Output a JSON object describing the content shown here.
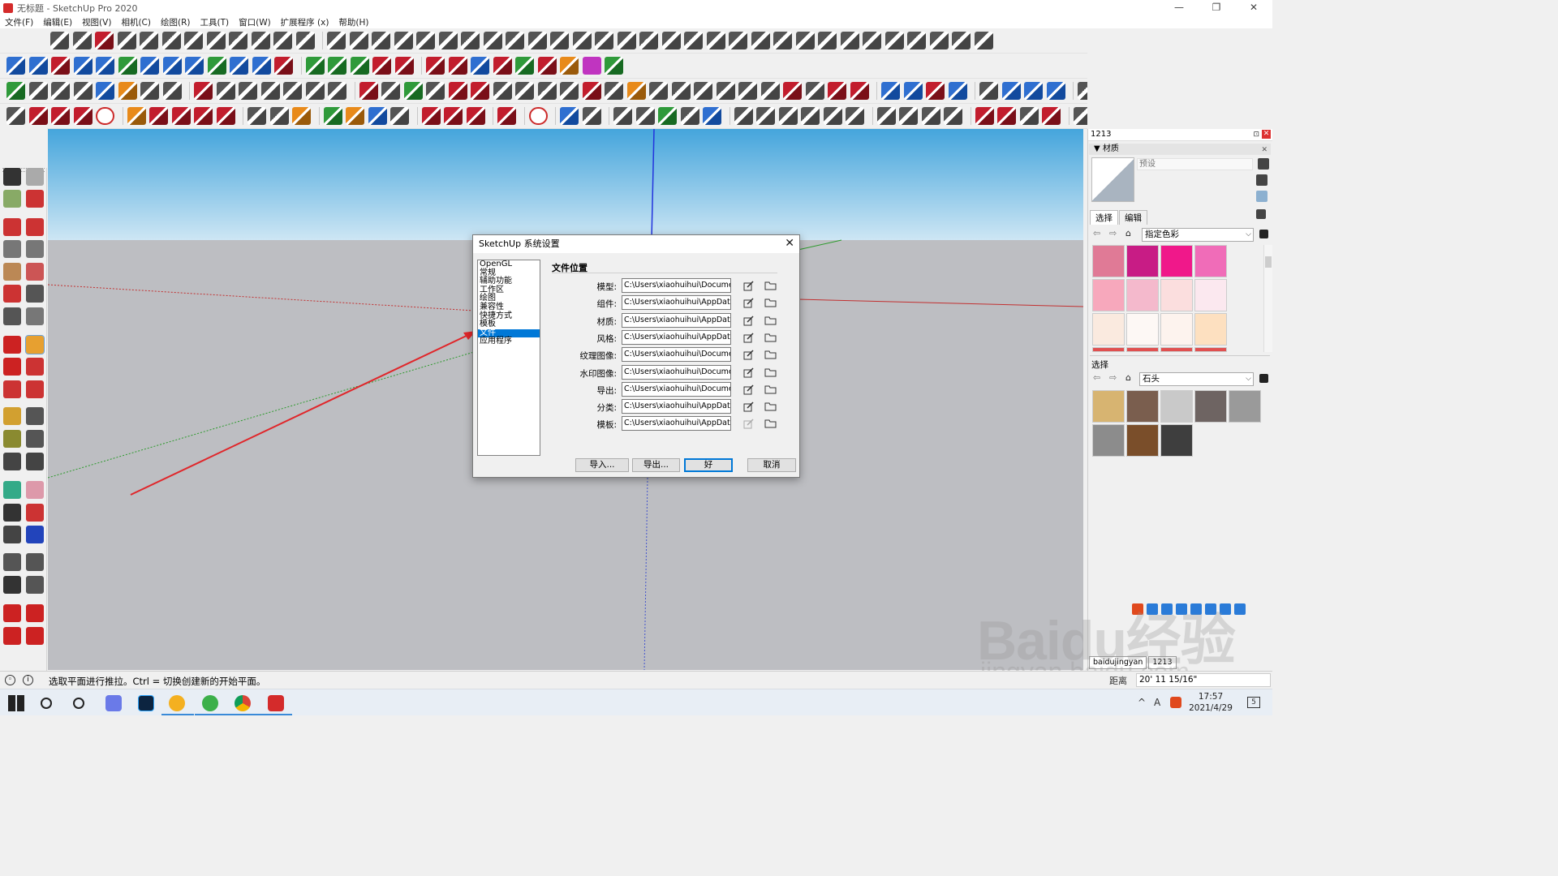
{
  "window": {
    "title": "无标题 - SketchUp Pro 2020",
    "min": "—",
    "restore": "❐",
    "close": "✕"
  },
  "menu": [
    "文件(F)",
    "编辑(E)",
    "视图(V)",
    "相机(C)",
    "绘图(R)",
    "工具(T)",
    "窗口(W)",
    "扩展程序 (x)",
    "帮助(H)"
  ],
  "dialog": {
    "title": "SketchUp 系统设置",
    "close": "✕",
    "categories": [
      "OpenGL",
      "常规",
      "辅助功能",
      "工作区",
      "绘图",
      "兼容性",
      "快捷方式",
      "模板",
      "文件",
      "应用程序"
    ],
    "selected_category": "文件",
    "section_title": "文件位置",
    "rows": [
      {
        "label": "模型:",
        "path": "C:\\Users\\xiaohuihui\\Documents\\"
      },
      {
        "label": "组件:",
        "path": "C:\\Users\\xiaohuihui\\AppData\\Roa"
      },
      {
        "label": "材质:",
        "path": "C:\\Users\\xiaohuihui\\AppData\\Roa"
      },
      {
        "label": "风格:",
        "path": "C:\\Users\\xiaohuihui\\AppData\\Roa"
      },
      {
        "label": "纹理图像:",
        "path": "C:\\Users\\xiaohuihui\\Documents\\"
      },
      {
        "label": "水印图像:",
        "path": "C:\\Users\\xiaohuihui\\Documents\\"
      },
      {
        "label": "导出:",
        "path": "C:\\Users\\xiaohuihui\\Documents\\"
      },
      {
        "label": "分类:",
        "path": "C:\\Users\\xiaohuihui\\AppData\\Roa"
      },
      {
        "label": "模板:",
        "path": "C:\\Users\\xiaohuihui\\AppData\\Roa"
      }
    ],
    "buttons": {
      "import": "导入...",
      "export": "导出...",
      "ok": "好",
      "cancel": "取消"
    }
  },
  "right_panel": {
    "tray_title": "1213",
    "pin": "⊡",
    "close": "✕",
    "materials_header": "▼ 材质",
    "name_placeholder": "预设",
    "tab_select": "选择",
    "tab_edit": "编辑",
    "collection1": "指定色彩",
    "select2": "选择",
    "collection2": "石头",
    "colors1": [
      "#e07a96",
      "#c81c85",
      "#f0188a",
      "#f06cb8",
      "#f7a8bc",
      "#f4b9cc",
      "#fbdede",
      "#fbe8ef",
      "#faeadf",
      "#fdf8f5",
      "#fdf3ee",
      "#fde0c0"
    ],
    "stones": [
      "#d7b471",
      "#7a5e4e",
      "#c9c9c9",
      "#6e6462",
      "#9a9a9a",
      "#8c8c8c",
      "#7a4e2a",
      "#3e3e3e"
    ]
  },
  "status": {
    "text": "选取平面进行推拉。Ctrl = 切换创建新的开始平面。",
    "distance_label": "距离",
    "distance_value": "20' 11 15/16\""
  },
  "bottom_tabs": [
    "baidujingyan",
    "1213"
  ],
  "clock": {
    "time": "17:57",
    "date": "2021/4/29"
  },
  "tray": {
    "chevron": "^",
    "lang": "A",
    "notif": "5"
  },
  "watermark": {
    "main": "Baidu经验",
    "sub": "jingyan.baidu.com"
  },
  "colors": {
    "accent": "#0078d7",
    "arrow": "#e0262a",
    "sketchup_red": "#d42b2b"
  }
}
